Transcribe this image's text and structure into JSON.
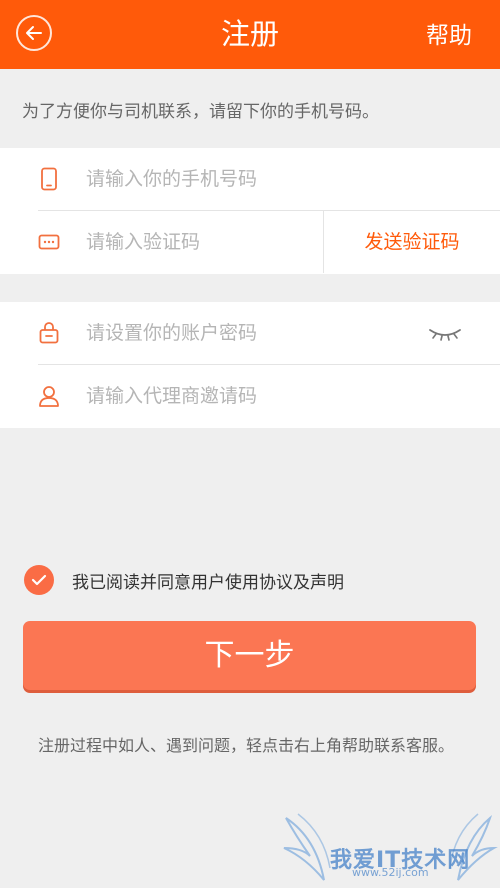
{
  "header": {
    "title": "注册",
    "help_label": "帮助",
    "back_icon": "back-arrow-icon",
    "background": "#ff5a0a"
  },
  "hint": "为了方便你与司机联系，请留下你的手机号码。",
  "phone_group": {
    "phone_placeholder": "请输入你的手机号码",
    "code_placeholder": "请输入验证码",
    "send_code_label": "发送验证码"
  },
  "account_group": {
    "password_placeholder": "请设置你的账户密码",
    "invite_placeholder": "请输入代理商邀请码"
  },
  "agreement": {
    "checked": true,
    "text": "我已阅读并同意用户使用协议及声明"
  },
  "next_button": "下一步",
  "footer_note": "注册过程中如人、遇到问题，轻点击右上角帮助联系客服。",
  "watermark": {
    "text": "我爱IT技术网",
    "sub": "www.52ij.com"
  },
  "colors": {
    "accent": "#ff5a0a",
    "button": "#fb7653",
    "icon": "#f2703f"
  }
}
